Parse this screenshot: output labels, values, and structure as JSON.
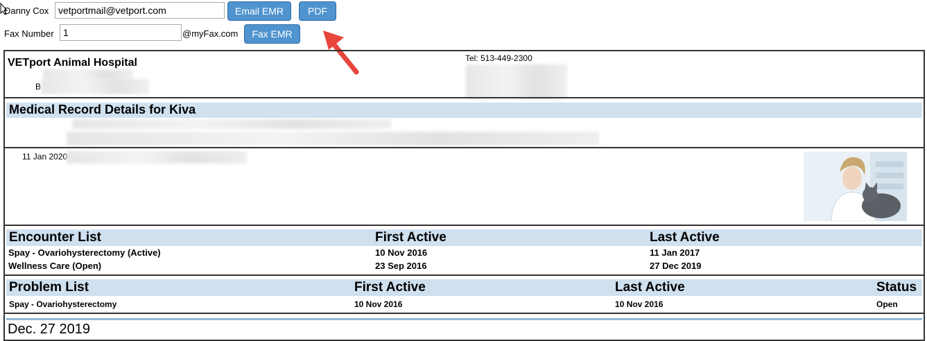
{
  "toolbar": {
    "client_name": "Danny Cox",
    "email_value": "vetportmail@vetport.com",
    "email_button": "Email EMR",
    "pdf_button": "PDF",
    "fax_label": "Fax Number",
    "fax_value": "1",
    "fax_domain": "@myFax.com",
    "fax_button": "Fax EMR"
  },
  "hospital": {
    "name": "VETport Animal Hospital",
    "address_prefix": "B",
    "tel": "Tel: 513-449-2300"
  },
  "record": {
    "title": "Medical Record Details for  Kiva",
    "client_line_visible": "Client Name: Cox (601) | 5134041507 | 1133 Hill Rd | Mason | Texas 45153"
  },
  "note": {
    "date": "11 Jan 2020"
  },
  "encounters": {
    "title": "Encounter List",
    "col_first": "First Active",
    "col_last": "Last Active",
    "rows": [
      {
        "name": "Spay - Ovariohysterectomy  (Active)",
        "first": "10 Nov 2016",
        "last": "11 Jan 2017"
      },
      {
        "name": "Wellness Care  (Open)",
        "first": "23 Sep 2016",
        "last": "27 Dec 2019"
      }
    ]
  },
  "problems": {
    "title": "Problem List",
    "col_first": "First Active",
    "col_last": "Last Active",
    "col_status": "Status",
    "rows": [
      {
        "name": "Spay - Ovariohysterectomy",
        "first": "10 Nov 2016",
        "last": "10 Nov 2016",
        "status": "Open"
      }
    ]
  },
  "footer": {
    "date": "Dec. 27 2019"
  },
  "colors": {
    "button": "#4f93cf",
    "band": "#cfe0ef",
    "arrow": "#e8453c"
  }
}
